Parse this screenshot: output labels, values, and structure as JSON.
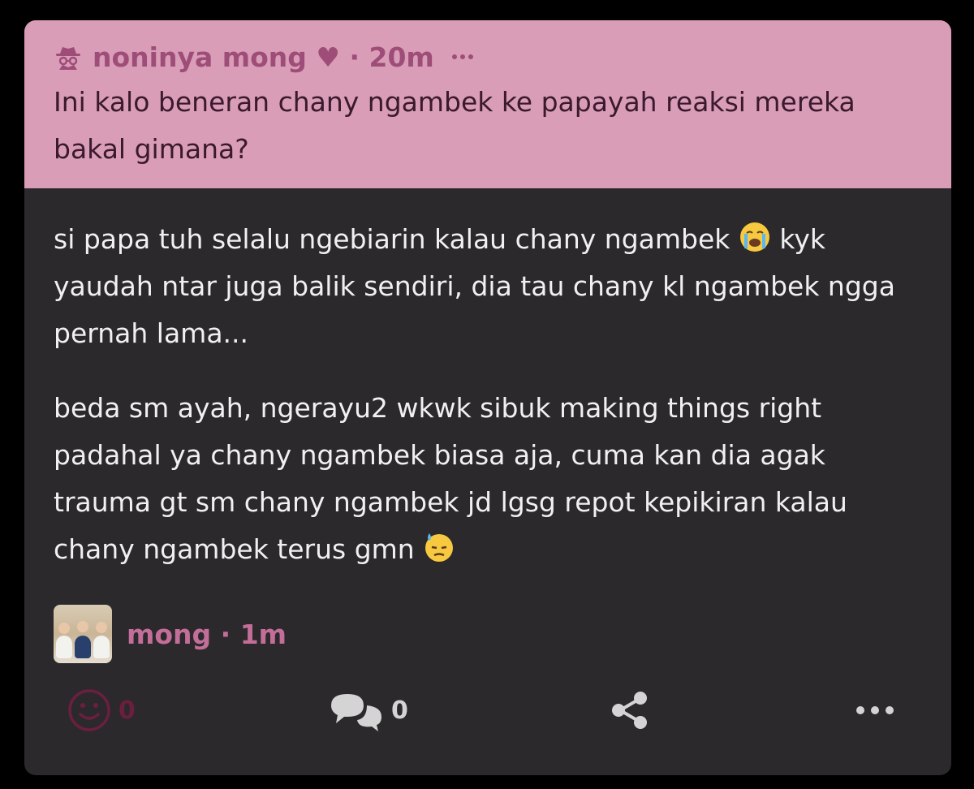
{
  "question": {
    "username": "noninya mong ♥",
    "separator": " · ",
    "time": "20m",
    "text": "Ini kalo beneran chany ngambek ke papayah reaksi mereka bakal gimana?"
  },
  "answer": {
    "paragraph1": "si papa tuh selalu ngebiarin kalau chany ngambek",
    "paragraph1_rest": " kyk yaudah ntar juga balik sendiri, dia tau chany kl ngambek ngga pernah lama...",
    "paragraph2": "beda sm ayah, ngerayu2 wkwk sibuk making things right padahal ya chany ngambek biasa aja, cuma kan dia agak trauma gt sm chany ngambek jd lgsg repot kepikiran kalau chany ngambek terus gmn",
    "author": "mong",
    "separator": " · ",
    "time": "1m"
  },
  "actions": {
    "reactions_count": "0",
    "comments_count": "0"
  },
  "icons": {
    "anon": "spy-icon",
    "emoji1": "loudly-crying-face-icon",
    "emoji2": "downcast-face-with-sweat-icon",
    "react": "smiley-icon",
    "comment": "speech-bubbles-icon",
    "share": "share-icon",
    "more": "more-dots-icon"
  },
  "colors": {
    "question_bg": "#d99db7",
    "card_bg": "#2b292c",
    "accent": "#c26e99"
  }
}
